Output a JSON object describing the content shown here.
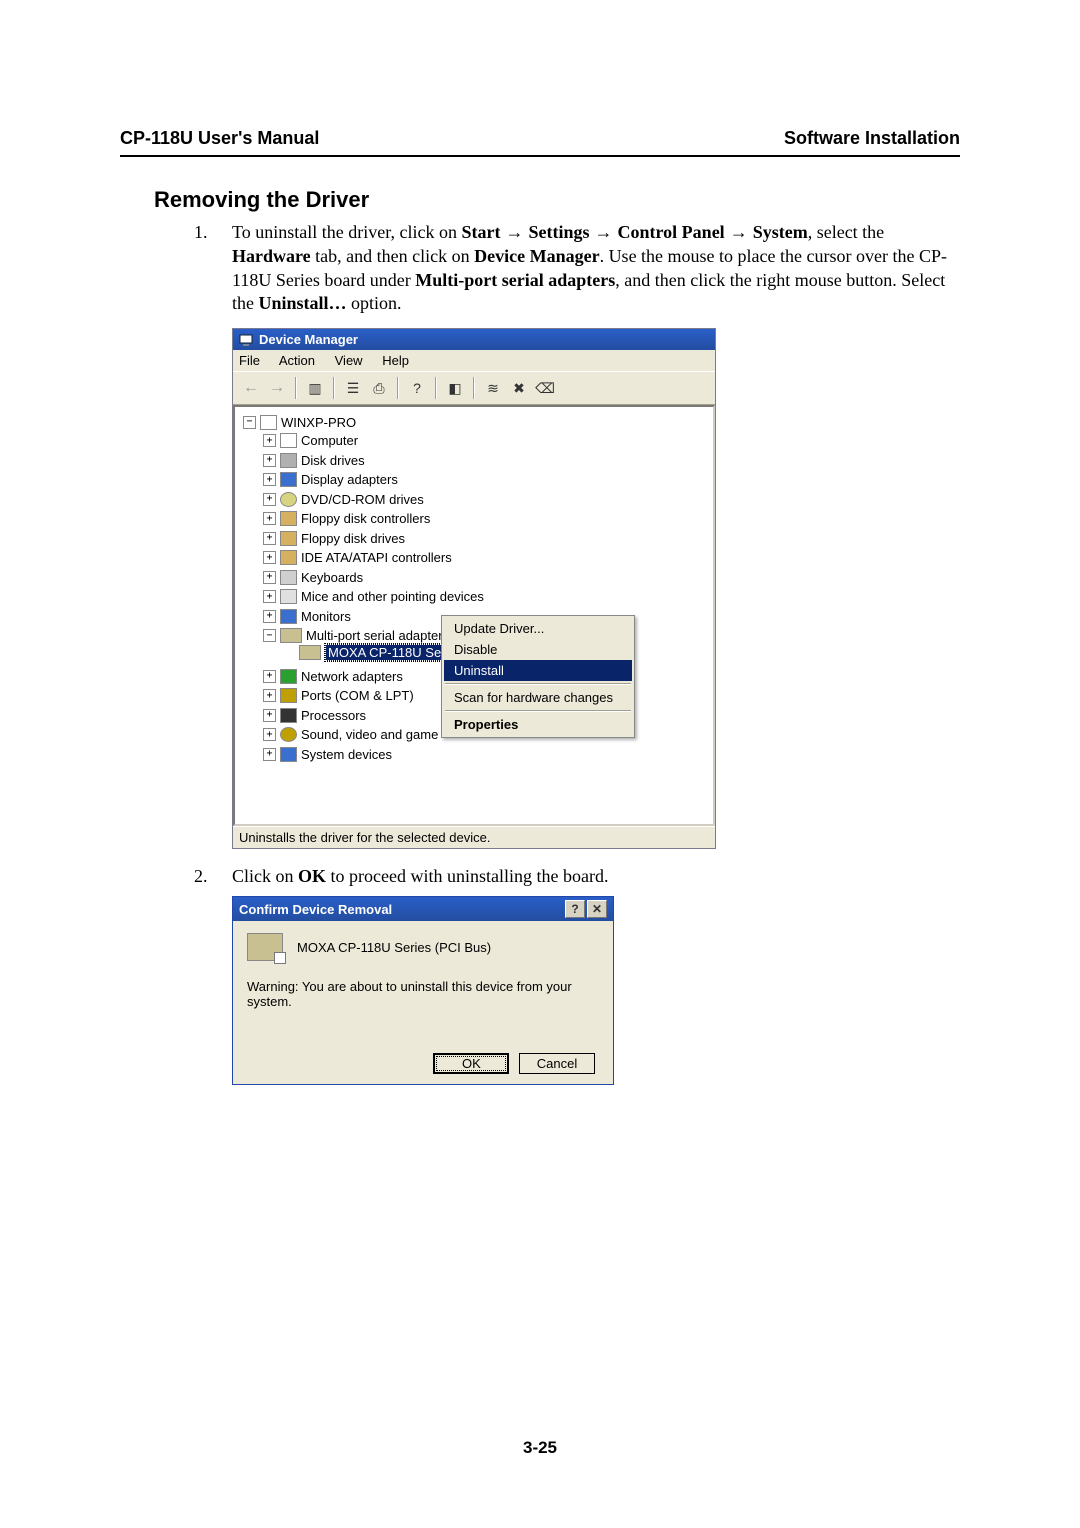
{
  "header": {
    "left": "CP-118U User's Manual",
    "right": "Software Installation"
  },
  "section_title": "Removing the Driver",
  "step1": {
    "num": "1.",
    "pre": "To uninstall the driver, click on ",
    "b1": "Start",
    "arr": " → ",
    "b2": "Settings",
    "b3": "Control Panel",
    "b4": "System",
    "mid1": ", select the ",
    "b5": "Hardware",
    "mid2": " tab, and then click on ",
    "b6": "Device Manager",
    "mid3": ". Use the mouse to place the cursor over the CP-118U Series board under ",
    "b7": "Multi-port serial adapters",
    "mid4": ", and then click the right mouse button. Select the ",
    "b8": "Uninstall…",
    "end": " option."
  },
  "devmgr": {
    "title": "Device Manager",
    "menus": [
      "File",
      "Action",
      "View",
      "Help"
    ],
    "root": "WINXP-PRO",
    "nodes": [
      {
        "icon": "comp",
        "label": "Computer"
      },
      {
        "icon": "disk",
        "label": "Disk drives"
      },
      {
        "icon": "disp",
        "label": "Display adapters"
      },
      {
        "icon": "cd",
        "label": "DVD/CD-ROM drives"
      },
      {
        "icon": "floppy",
        "label": "Floppy disk controllers"
      },
      {
        "icon": "floppy",
        "label": "Floppy disk drives"
      },
      {
        "icon": "floppy",
        "label": "IDE ATA/ATAPI controllers"
      },
      {
        "icon": "kbd",
        "label": "Keyboards"
      },
      {
        "icon": "mice",
        "label": "Mice and other pointing devices"
      },
      {
        "icon": "mon",
        "label": "Monitors"
      }
    ],
    "mp_parent": "Multi-port serial adapters",
    "mp_child": "MOXA CP-118U Series (PCI Bus)",
    "after": [
      {
        "icon": "net",
        "label": "Network adapters"
      },
      {
        "icon": "port",
        "label": "Ports (COM & LPT)"
      },
      {
        "icon": "proc",
        "label": "Processors"
      },
      {
        "icon": "snd",
        "label": "Sound, video and game"
      },
      {
        "icon": "sys",
        "label": "System devices"
      }
    ],
    "ctx": {
      "update": "Update Driver...",
      "disable": "Disable",
      "uninstall": "Uninstall",
      "scan": "Scan for hardware changes",
      "props": "Properties"
    },
    "status": "Uninstalls the driver for the selected device."
  },
  "step2": {
    "num": "2.",
    "pre": "Click on ",
    "b1": "OK",
    "post": " to proceed with uninstalling the board."
  },
  "confirm": {
    "title": "Confirm Device Removal",
    "device": "MOXA CP-118U Series (PCI Bus)",
    "warning": "Warning: You are about to uninstall this device from your system.",
    "ok": "OK",
    "cancel": "Cancel"
  },
  "page_number": "3-25"
}
